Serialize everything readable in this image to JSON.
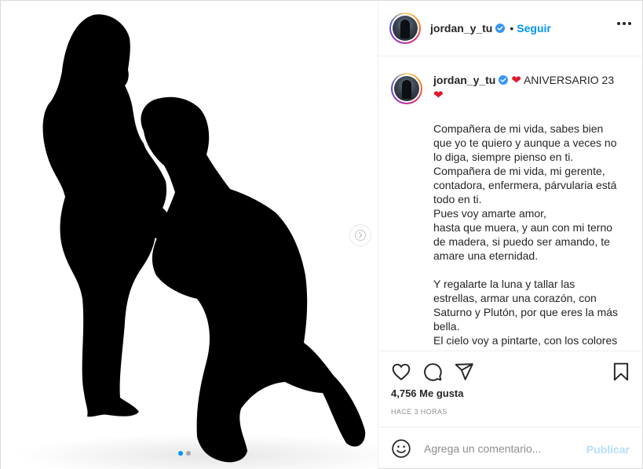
{
  "post": {
    "username": "jordan_y_tu",
    "follow_label": "Seguir",
    "separator": "•",
    "caption": {
      "title": "ANIVERSARIO 23",
      "heart_emoji": "❤",
      "body": "Compañera de mi vida, sabes bien que yo te quiero y aunque a veces no lo diga, siempre pienso en ti.\nCompañera de mi vida, mi gerente, contadora, enfermera, párvularia está todo en ti.\nPues voy amarte amor,\nhasta que muera, y aun con mi terno de madera, si puedo ser amando, te amare una eternidad.\n\nY regalarte la luna y tallar las estrellas, armar una corazón, con Saturno y Plutón, por que eres la más bella.\nEl cielo voy a pintarte, con los colores de Marte, rojo como el corazón, te"
    },
    "likes": "4,756 Me gusta",
    "timestamp": "HACE 3 HORAS",
    "comment": {
      "placeholder": "Agrega un comentario...",
      "publish_label": "Publicar"
    },
    "carousel": {
      "total": 2,
      "active_index": 0
    },
    "icons": {
      "like": "heart-icon",
      "comment": "comment-icon",
      "share": "share-icon",
      "save": "bookmark-icon",
      "emoji": "smiley-icon",
      "more": "more-options-icon",
      "verified": "verified-badge-icon",
      "next": "chevron-right-icon"
    },
    "colors": {
      "accent": "#0095f6",
      "publish_disabled": "#b2dffc",
      "heart": "#e0182d"
    }
  }
}
